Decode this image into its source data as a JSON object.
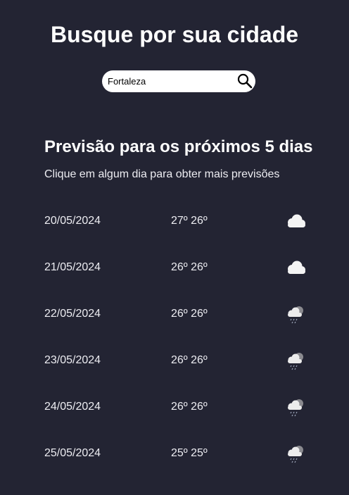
{
  "header": {
    "title": "Busque por sua cidade"
  },
  "search": {
    "value": "Fortaleza",
    "icon": "search-icon"
  },
  "forecast": {
    "title": "Previsão para os próximos 5 dias",
    "subtitle": "Clique em algum dia para obter mais previsões",
    "days": [
      {
        "date": "20/05/2024",
        "temp": "27º 26º",
        "icon": "cloud-icon"
      },
      {
        "date": "21/05/2024",
        "temp": "26º 26º",
        "icon": "cloud-icon"
      },
      {
        "date": "22/05/2024",
        "temp": "26º 26º",
        "icon": "rain-cloud-icon"
      },
      {
        "date": "23/05/2024",
        "temp": "26º 26º",
        "icon": "rain-cloud-icon"
      },
      {
        "date": "24/05/2024",
        "temp": "26º 26º",
        "icon": "rain-cloud-icon"
      },
      {
        "date": "25/05/2024",
        "temp": "25º 25º",
        "icon": "rain-cloud-icon"
      }
    ]
  },
  "colors": {
    "background": "#232433",
    "text": "#ffffff"
  }
}
